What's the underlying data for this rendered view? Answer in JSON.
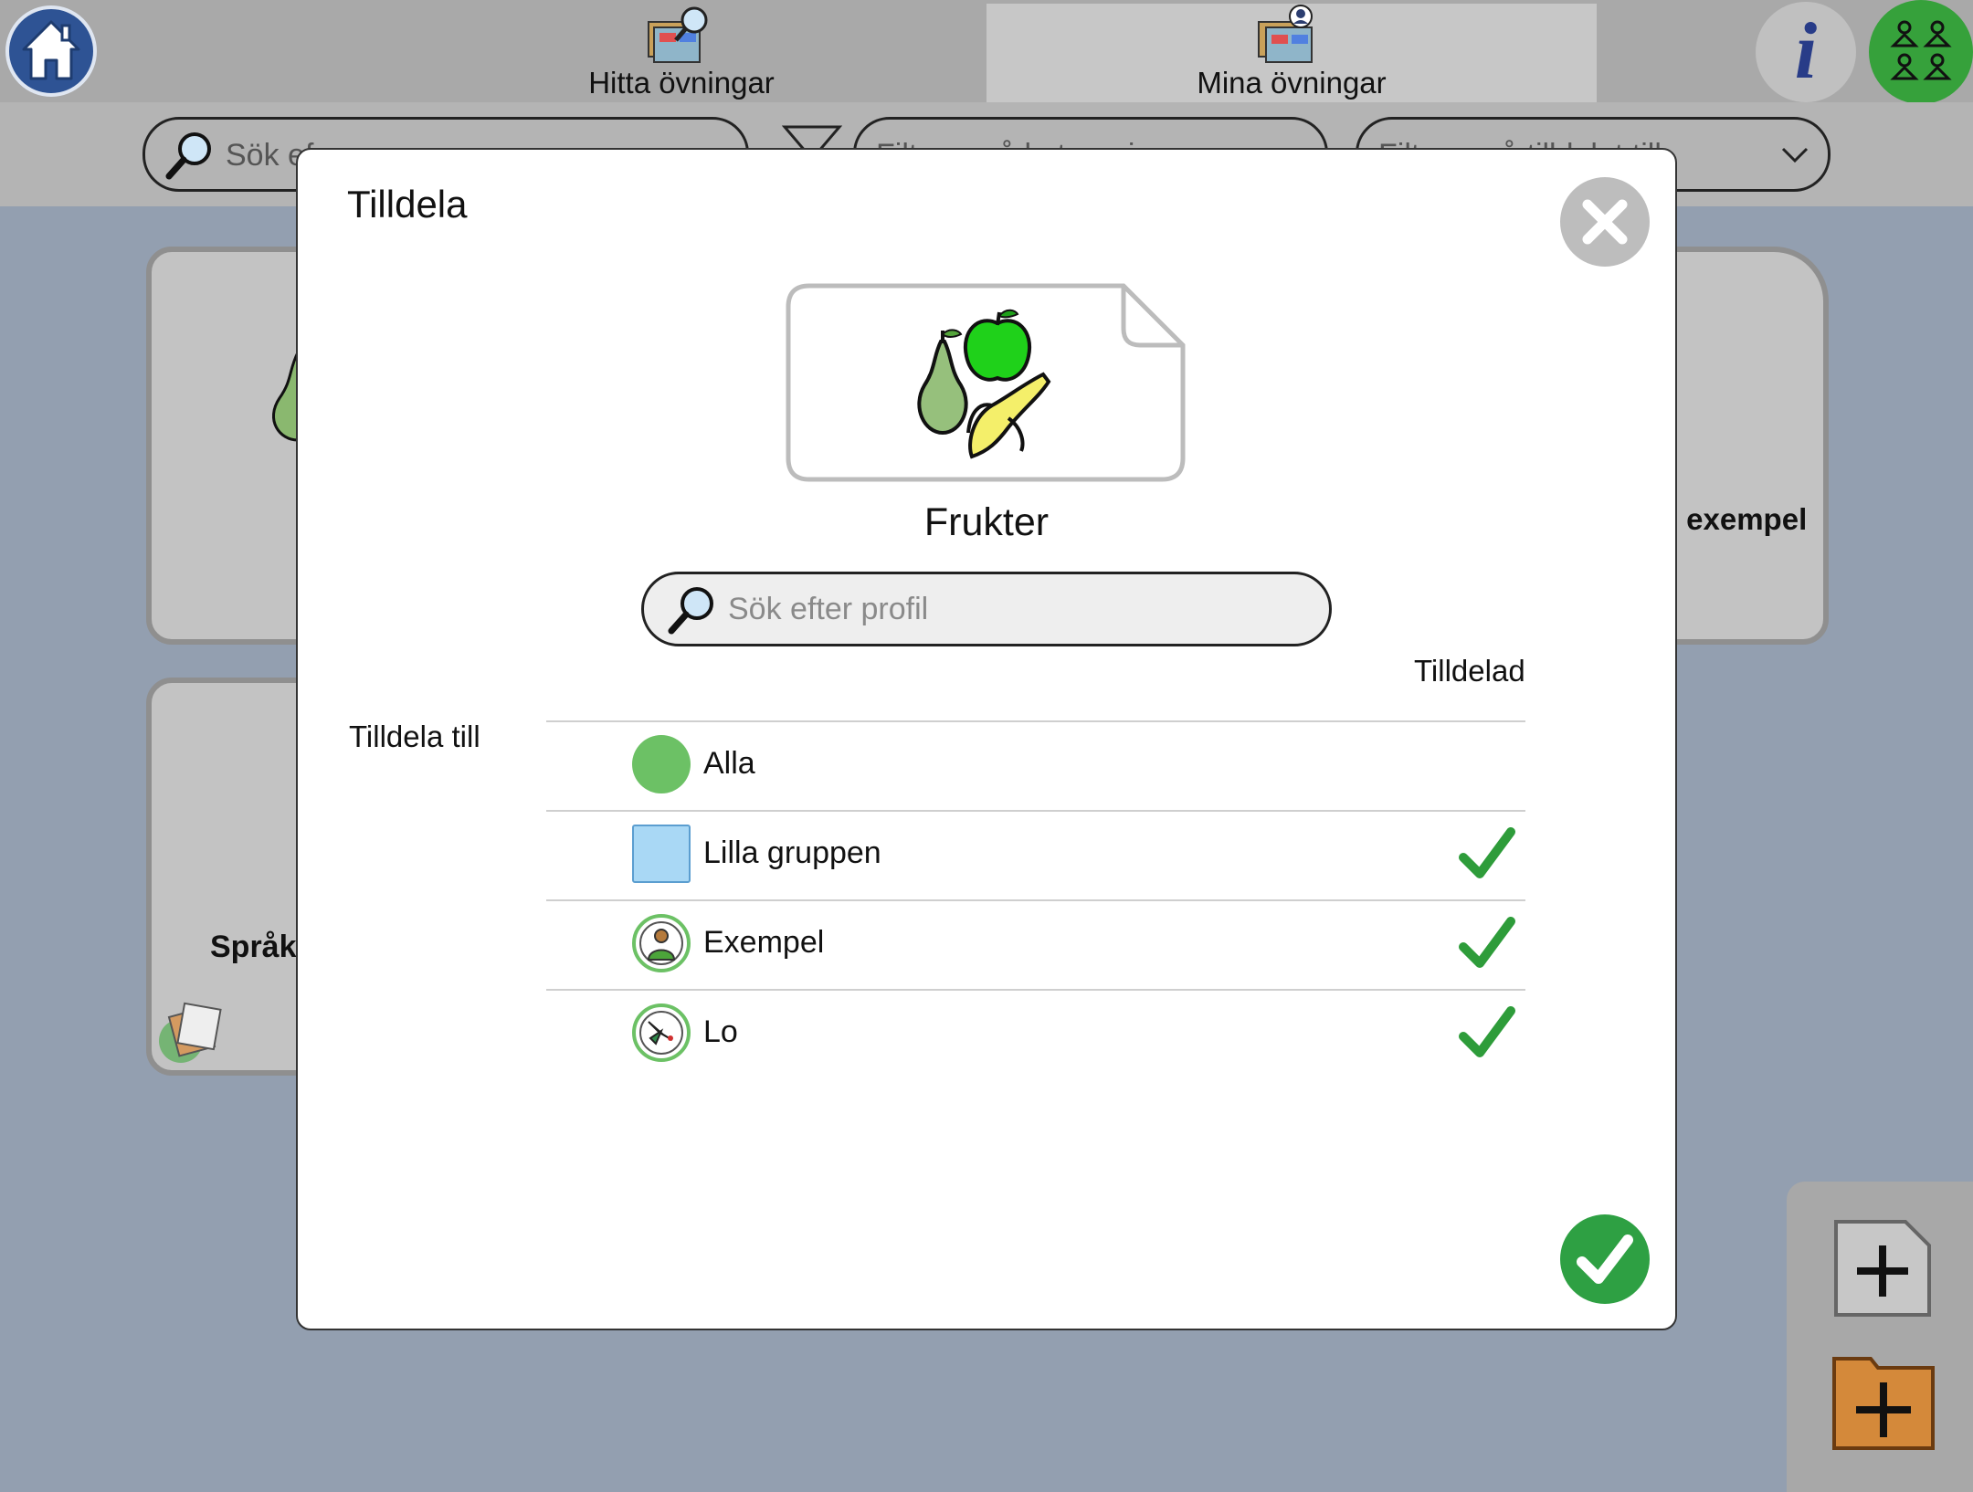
{
  "topbar": {
    "tabs": [
      {
        "label": "Hitta övningar",
        "active": false
      },
      {
        "label": "Mina övningar",
        "active": true
      }
    ],
    "home_icon": "home-icon",
    "info_icon": "info-icon",
    "info_glyph": "i",
    "groups_icon": "groups-icon"
  },
  "filters": {
    "search_placeholder": "Sök ef",
    "category_placeholder": "Filtrera på kategori",
    "assigned_placeholder": "Filtrera på tilldelat till"
  },
  "background_cards": [
    {
      "label": ""
    },
    {
      "label": "- exempel"
    },
    {
      "label": "Språk"
    }
  ],
  "modal": {
    "title": "Tilldela",
    "exercise_name": "Frukter",
    "search_placeholder": "Sök efter profil",
    "search_value": "",
    "assigned_header": "Tilldelad",
    "assign_to_label": "Tilldela till",
    "profiles": [
      {
        "name": "Alla",
        "icon": "all-circle-icon",
        "assigned": false
      },
      {
        "name": "Lilla gruppen",
        "icon": "group-square-icon",
        "assigned": true
      },
      {
        "name": "Exempel",
        "icon": "person-avatar-icon",
        "assigned": true
      },
      {
        "name": "Lo",
        "icon": "hummingbird-avatar-icon",
        "assigned": true
      }
    ]
  },
  "colors": {
    "accent_green": "#2ea043",
    "home_blue": "#2e5394",
    "info_blue": "#283c88",
    "alla_green": "#6cc165",
    "group_blue": "#a9d8f5"
  }
}
